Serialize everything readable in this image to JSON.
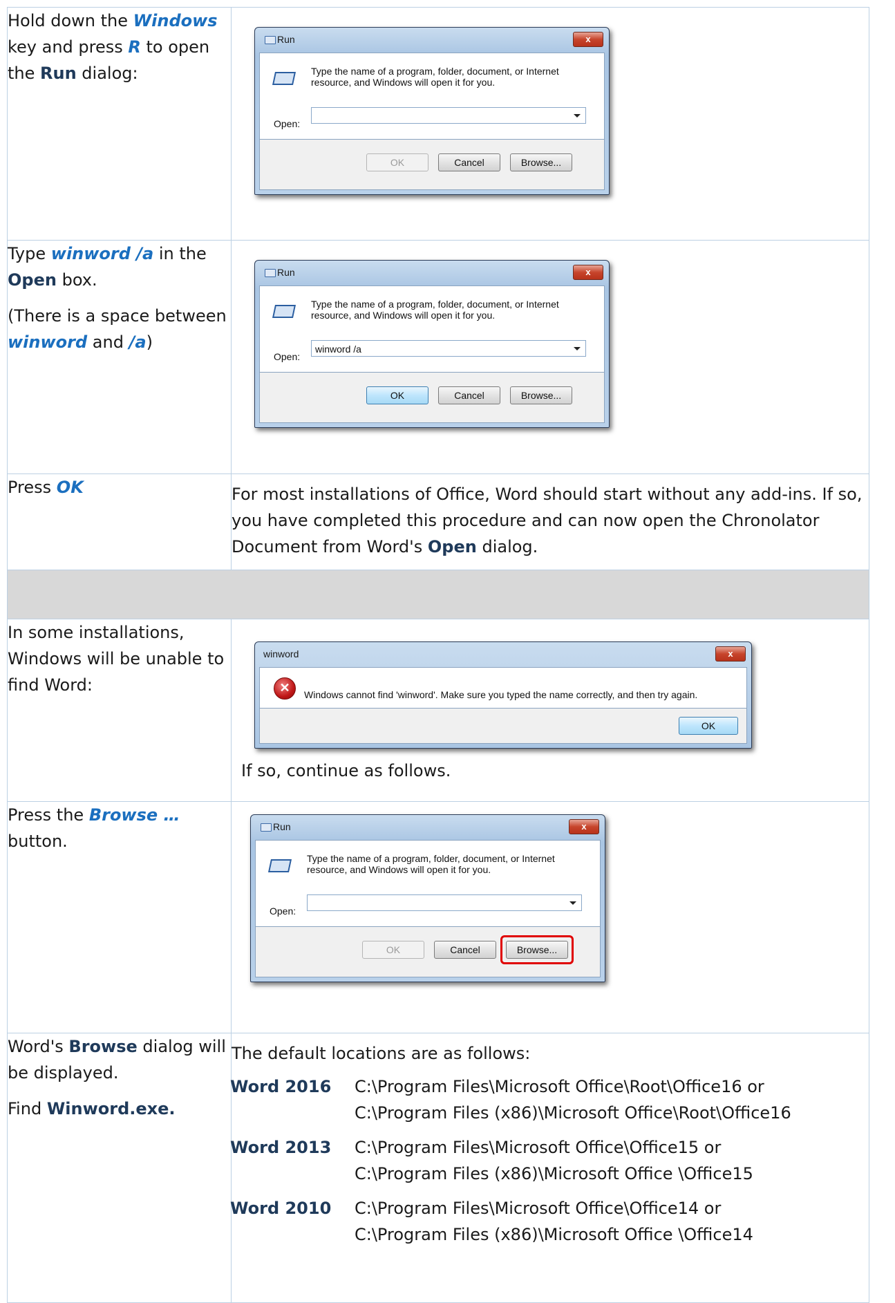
{
  "row1": {
    "instruction": [
      "Hold down the ",
      "Windows",
      " key and press ",
      "R",
      " to open the ",
      "Run",
      " dialog:"
    ],
    "dialog": {
      "title": "Run",
      "close": "x",
      "message_line1": "Type the name of a program, folder, document, or Internet",
      "message_line2": "resource, and Windows will open it for you.",
      "open_label": "Open:",
      "open_value": "",
      "ok_label": "OK",
      "cancel_label": "Cancel",
      "browse_label": "Browse..."
    }
  },
  "row2": {
    "instruction_a": [
      "Type ",
      "winword /a",
      " in the ",
      "Open",
      " box."
    ],
    "instruction_b": [
      "(There is a space between ",
      "winword",
      " and ",
      "/a",
      ")"
    ],
    "dialog": {
      "title": "Run",
      "close": "x",
      "message_line1": "Type the name of a program, folder, document, or Internet",
      "message_line2": "resource, and Windows will open it for you.",
      "open_label": "Open:",
      "open_value": "winword /a",
      "ok_label": "OK",
      "cancel_label": "Cancel",
      "browse_label": "Browse..."
    }
  },
  "row3": {
    "instruction": [
      "Press ",
      "OK"
    ],
    "description": [
      "For most installations of Office, Word should start without any add-ins. If so, you have completed this procedure and can now open the Chronolator Document from Word's ",
      "Open",
      " dialog."
    ]
  },
  "row4": {
    "instruction": "In some installations, Windows will be unable to find Word:",
    "error_dialog": {
      "title": "winword",
      "close": "x",
      "message": "Windows cannot find 'winword'. Make sure you typed the name correctly, and then try again.",
      "ok_label": "OK"
    },
    "followup": "If so, continue as follows."
  },
  "row5": {
    "instruction": [
      "Press the ",
      "Browse …",
      " button."
    ],
    "dialog": {
      "title": "Run",
      "close": "x",
      "message_line1": "Type the name of a program, folder, document, or Internet",
      "message_line2": "resource, and Windows will open it for you.",
      "open_label": "Open:",
      "open_value": "",
      "ok_label": "OK",
      "cancel_label": "Cancel",
      "browse_label": "Browse..."
    }
  },
  "row6": {
    "instruction_a": [
      "Word's ",
      "Browse",
      " dialog will be displayed."
    ],
    "instruction_b": [
      "Find ",
      "Winword.exe."
    ],
    "intro": "The default locations are as follows:",
    "locations": [
      {
        "version": "Word 2016",
        "path1": "C:\\Program Files\\Microsoft Office\\Root\\Office16 or",
        "path2": "C:\\Program Files (x86)\\Microsoft Office\\Root\\Office16"
      },
      {
        "version": "Word 2013",
        "path1": "C:\\Program Files\\Microsoft Office\\Office15 or",
        "path2": "C:\\Program Files (x86)\\Microsoft Office \\Office15"
      },
      {
        "version": "Word 2010",
        "path1": "C:\\Program Files\\Microsoft Office\\Office14 or",
        "path2": "C:\\Program Files (x86)\\Microsoft Office \\Office14"
      }
    ]
  },
  "colors": {
    "accent": "#1b6fbf",
    "heading": "#1f3a5a",
    "border": "#bcd0e3",
    "separator": "#d8d8d8",
    "highlight": "#e00000"
  }
}
